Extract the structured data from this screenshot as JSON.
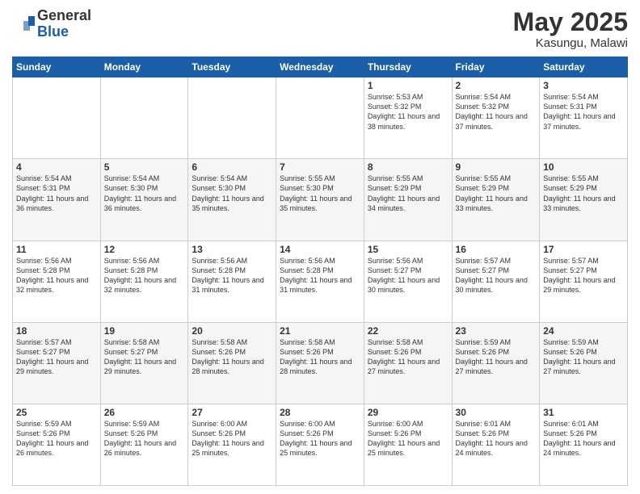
{
  "header": {
    "logo_general": "General",
    "logo_blue": "Blue",
    "month": "May 2025",
    "location": "Kasungu, Malawi"
  },
  "days_of_week": [
    "Sunday",
    "Monday",
    "Tuesday",
    "Wednesday",
    "Thursday",
    "Friday",
    "Saturday"
  ],
  "weeks": [
    [
      {
        "day": "",
        "text": ""
      },
      {
        "day": "",
        "text": ""
      },
      {
        "day": "",
        "text": ""
      },
      {
        "day": "",
        "text": ""
      },
      {
        "day": "1",
        "text": "Sunrise: 5:53 AM\nSunset: 5:32 PM\nDaylight: 11 hours\nand 38 minutes."
      },
      {
        "day": "2",
        "text": "Sunrise: 5:54 AM\nSunset: 5:32 PM\nDaylight: 11 hours\nand 37 minutes."
      },
      {
        "day": "3",
        "text": "Sunrise: 5:54 AM\nSunset: 5:31 PM\nDaylight: 11 hours\nand 37 minutes."
      }
    ],
    [
      {
        "day": "4",
        "text": "Sunrise: 5:54 AM\nSunset: 5:31 PM\nDaylight: 11 hours\nand 36 minutes."
      },
      {
        "day": "5",
        "text": "Sunrise: 5:54 AM\nSunset: 5:30 PM\nDaylight: 11 hours\nand 36 minutes."
      },
      {
        "day": "6",
        "text": "Sunrise: 5:54 AM\nSunset: 5:30 PM\nDaylight: 11 hours\nand 35 minutes."
      },
      {
        "day": "7",
        "text": "Sunrise: 5:55 AM\nSunset: 5:30 PM\nDaylight: 11 hours\nand 35 minutes."
      },
      {
        "day": "8",
        "text": "Sunrise: 5:55 AM\nSunset: 5:29 PM\nDaylight: 11 hours\nand 34 minutes."
      },
      {
        "day": "9",
        "text": "Sunrise: 5:55 AM\nSunset: 5:29 PM\nDaylight: 11 hours\nand 33 minutes."
      },
      {
        "day": "10",
        "text": "Sunrise: 5:55 AM\nSunset: 5:29 PM\nDaylight: 11 hours\nand 33 minutes."
      }
    ],
    [
      {
        "day": "11",
        "text": "Sunrise: 5:56 AM\nSunset: 5:28 PM\nDaylight: 11 hours\nand 32 minutes."
      },
      {
        "day": "12",
        "text": "Sunrise: 5:56 AM\nSunset: 5:28 PM\nDaylight: 11 hours\nand 32 minutes."
      },
      {
        "day": "13",
        "text": "Sunrise: 5:56 AM\nSunset: 5:28 PM\nDaylight: 11 hours\nand 31 minutes."
      },
      {
        "day": "14",
        "text": "Sunrise: 5:56 AM\nSunset: 5:28 PM\nDaylight: 11 hours\nand 31 minutes."
      },
      {
        "day": "15",
        "text": "Sunrise: 5:56 AM\nSunset: 5:27 PM\nDaylight: 11 hours\nand 30 minutes."
      },
      {
        "day": "16",
        "text": "Sunrise: 5:57 AM\nSunset: 5:27 PM\nDaylight: 11 hours\nand 30 minutes."
      },
      {
        "day": "17",
        "text": "Sunrise: 5:57 AM\nSunset: 5:27 PM\nDaylight: 11 hours\nand 29 minutes."
      }
    ],
    [
      {
        "day": "18",
        "text": "Sunrise: 5:57 AM\nSunset: 5:27 PM\nDaylight: 11 hours\nand 29 minutes."
      },
      {
        "day": "19",
        "text": "Sunrise: 5:58 AM\nSunset: 5:27 PM\nDaylight: 11 hours\nand 29 minutes."
      },
      {
        "day": "20",
        "text": "Sunrise: 5:58 AM\nSunset: 5:26 PM\nDaylight: 11 hours\nand 28 minutes."
      },
      {
        "day": "21",
        "text": "Sunrise: 5:58 AM\nSunset: 5:26 PM\nDaylight: 11 hours\nand 28 minutes."
      },
      {
        "day": "22",
        "text": "Sunrise: 5:58 AM\nSunset: 5:26 PM\nDaylight: 11 hours\nand 27 minutes."
      },
      {
        "day": "23",
        "text": "Sunrise: 5:59 AM\nSunset: 5:26 PM\nDaylight: 11 hours\nand 27 minutes."
      },
      {
        "day": "24",
        "text": "Sunrise: 5:59 AM\nSunset: 5:26 PM\nDaylight: 11 hours\nand 27 minutes."
      }
    ],
    [
      {
        "day": "25",
        "text": "Sunrise: 5:59 AM\nSunset: 5:26 PM\nDaylight: 11 hours\nand 26 minutes."
      },
      {
        "day": "26",
        "text": "Sunrise: 5:59 AM\nSunset: 5:26 PM\nDaylight: 11 hours\nand 26 minutes."
      },
      {
        "day": "27",
        "text": "Sunrise: 6:00 AM\nSunset: 5:26 PM\nDaylight: 11 hours\nand 25 minutes."
      },
      {
        "day": "28",
        "text": "Sunrise: 6:00 AM\nSunset: 5:26 PM\nDaylight: 11 hours\nand 25 minutes."
      },
      {
        "day": "29",
        "text": "Sunrise: 6:00 AM\nSunset: 5:26 PM\nDaylight: 11 hours\nand 25 minutes."
      },
      {
        "day": "30",
        "text": "Sunrise: 6:01 AM\nSunset: 5:26 PM\nDaylight: 11 hours\nand 24 minutes."
      },
      {
        "day": "31",
        "text": "Sunrise: 6:01 AM\nSunset: 5:26 PM\nDaylight: 11 hours\nand 24 minutes."
      }
    ]
  ]
}
